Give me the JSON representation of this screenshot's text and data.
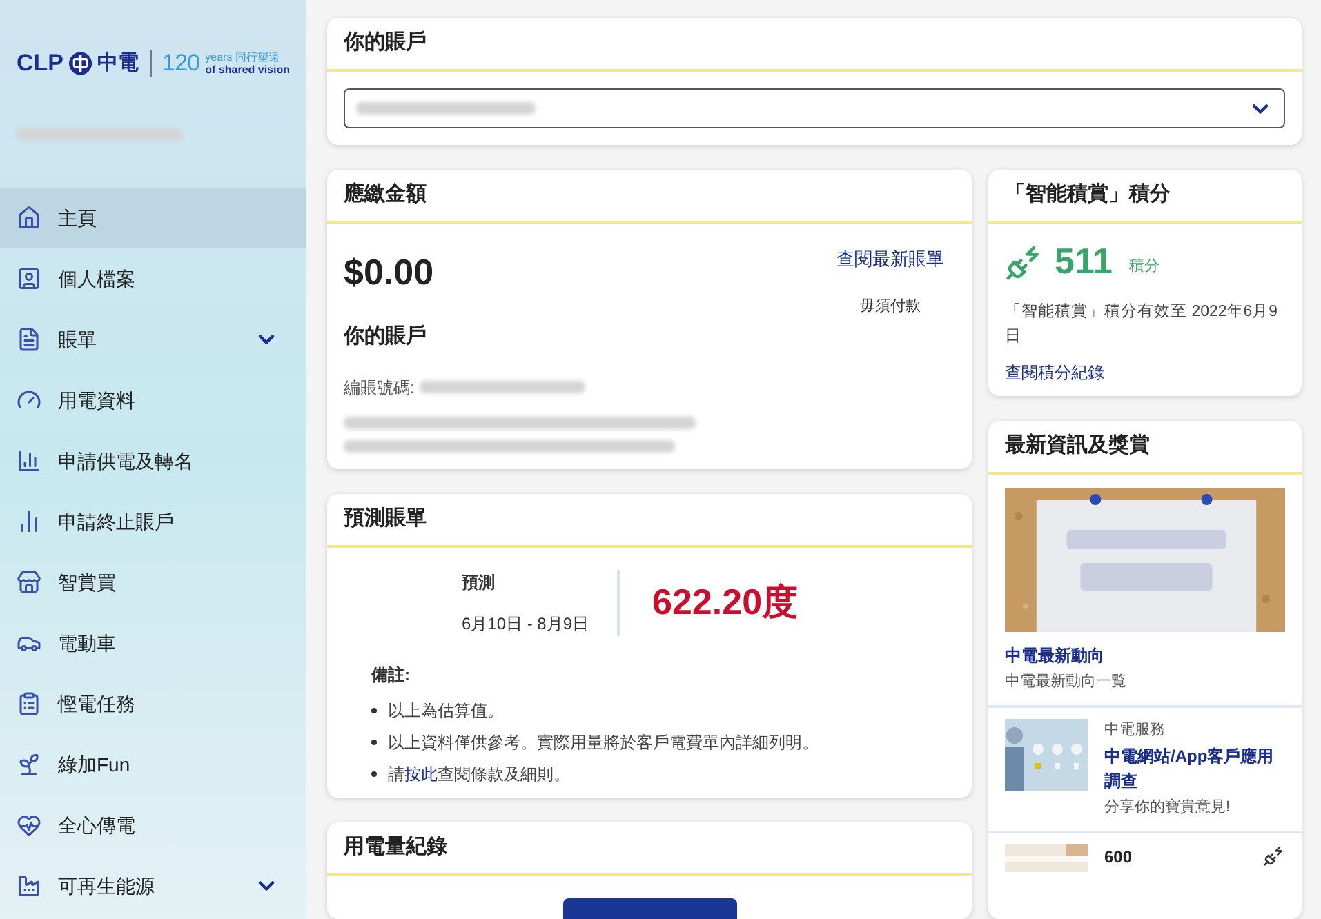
{
  "logo": {
    "brand": "CLP",
    "brand_cn": "中電",
    "anniversary": "120",
    "years": "years 同行望遠",
    "tagline": "of shared vision"
  },
  "sidebar": {
    "items": [
      {
        "label": "主頁",
        "selected": true,
        "expandable": false
      },
      {
        "label": "個人檔案",
        "selected": false,
        "expandable": false
      },
      {
        "label": "賬單",
        "selected": false,
        "expandable": true
      },
      {
        "label": "用電資料",
        "selected": false,
        "expandable": false
      },
      {
        "label": "申請供電及轉名",
        "selected": false,
        "expandable": false
      },
      {
        "label": "申請終止賬戶",
        "selected": false,
        "expandable": false
      },
      {
        "label": "智賞買",
        "selected": false,
        "expandable": false
      },
      {
        "label": "電動車",
        "selected": false,
        "expandable": false
      },
      {
        "label": "慳電任務",
        "selected": false,
        "expandable": false
      },
      {
        "label": "綠加Fun",
        "selected": false,
        "expandable": false
      },
      {
        "label": "全心傳電",
        "selected": false,
        "expandable": false
      },
      {
        "label": "可再生能源",
        "selected": false,
        "expandable": true
      }
    ]
  },
  "account_card": {
    "title": "你的賬戶"
  },
  "amount_card": {
    "title": "應繳金額",
    "amount": "$0.00",
    "link": "查閱最新賬單",
    "status": "毋須付款",
    "account_heading": "你的賬戶",
    "account_no_label": "編賬號碼:"
  },
  "forecast_card": {
    "title": "預測賬單",
    "period_label": "預測",
    "period": "6月10日 - 8月9日",
    "value": "622.20度",
    "notes_title": "備註:",
    "notes": [
      {
        "prefix": "以上為估算值。"
      },
      {
        "prefix": "以上資料僅供參考。實際用量將於客戶電費單內詳細列明。"
      },
      {
        "prefix": "請",
        "link": "按此",
        "suffix": "查閱條款及細則。"
      }
    ]
  },
  "usage_card": {
    "title": "用電量紀錄"
  },
  "points_card": {
    "title": "「智能積賞」積分",
    "points": "511",
    "unit": "積分",
    "validity": "「智能積賞」積分有效至 2022年6月9日",
    "link": "查閱積分紀錄"
  },
  "news_card": {
    "title": "最新資訊及獎賞",
    "items": [
      {
        "kind": "feature",
        "title": "中電最新動向",
        "subtitle": "中電最新動向一覧"
      },
      {
        "kind": "row",
        "category": "中電服務",
        "title": "中電網站/App客戶應用調查",
        "subtitle": "分享你的寶貴意見!"
      },
      {
        "kind": "points",
        "title": "600"
      }
    ]
  }
}
